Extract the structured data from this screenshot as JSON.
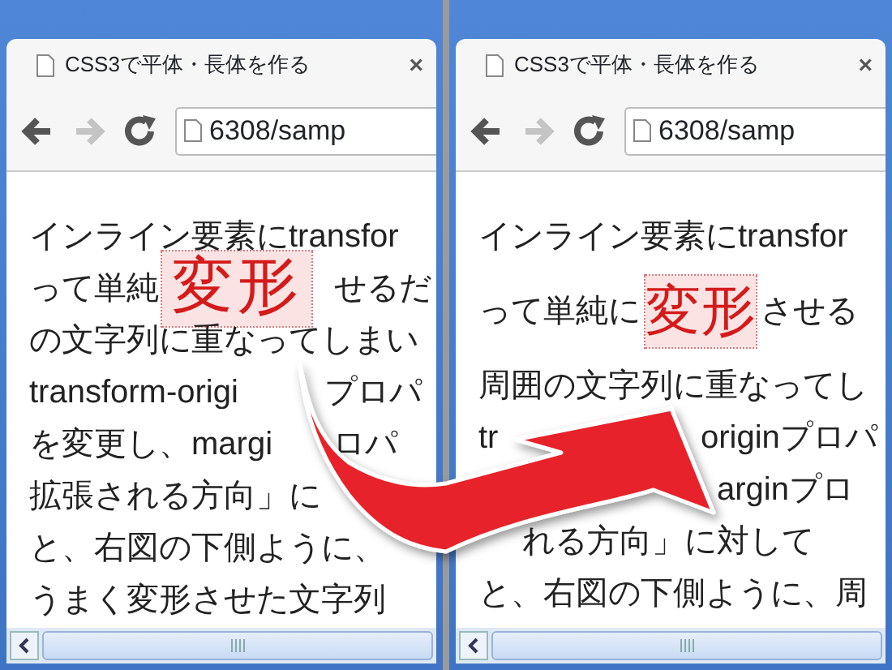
{
  "windows": [
    {
      "tab": {
        "title": "CSS3で平体・長体を作る",
        "close": "×"
      },
      "toolbar": {
        "forward_disabled": true,
        "address": "6308/samp"
      },
      "lines": [
        [
          {
            "kind": "text",
            "text": "インライン要素にtransfor"
          }
        ],
        [
          {
            "kind": "text",
            "text": "って単純"
          },
          {
            "kind": "squashed",
            "text": "変形"
          },
          {
            "kind": "text",
            "text": "せるだ"
          }
        ],
        [
          {
            "kind": "text",
            "text": "の文字列に重なってしまい"
          }
        ],
        [
          {
            "kind": "text",
            "text": "transform-origi"
          },
          {
            "kind": "covered"
          },
          {
            "kind": "text",
            "text": "プロパ"
          }
        ],
        [
          {
            "kind": "text",
            "text": "を変更し、margi"
          },
          {
            "kind": "covered"
          },
          {
            "kind": "text",
            "text": "ロパ"
          }
        ],
        [
          {
            "kind": "text",
            "text": "拡張される方向」に"
          }
        ],
        [
          {
            "kind": "text",
            "text": "と、右図の下側ように、"
          }
        ],
        [
          {
            "kind": "text",
            "text": "うまく変形させた文字列"
          }
        ]
      ]
    },
    {
      "tab": {
        "title": "CSS3で平体・長体を作る",
        "close": "×"
      },
      "toolbar": {
        "forward_disabled": true,
        "address": "6308/samp"
      },
      "lines": [
        [
          {
            "kind": "text",
            "text": "インライン要素にtransfor"
          }
        ],
        [
          {
            "kind": "text",
            "text": "って単純に"
          },
          {
            "kind": "enlarged",
            "text": "変形"
          },
          {
            "kind": "text",
            "text": "させる"
          }
        ],
        [
          {
            "kind": "text",
            "text": "周囲の文字列に重なってし"
          }
        ],
        [
          {
            "kind": "text",
            "text": "tr"
          },
          {
            "kind": "covered"
          },
          {
            "kind": "text",
            "text": "originプロパ"
          }
        ],
        [
          {
            "kind": "covered"
          },
          {
            "kind": "text",
            "text": "arginプロ"
          }
        ],
        [
          {
            "kind": "covered"
          },
          {
            "kind": "text",
            "text": "れる方向」に対して"
          }
        ],
        [
          {
            "kind": "text",
            "text": "と、右図の下側ように、周"
          }
        ]
      ]
    }
  ]
}
